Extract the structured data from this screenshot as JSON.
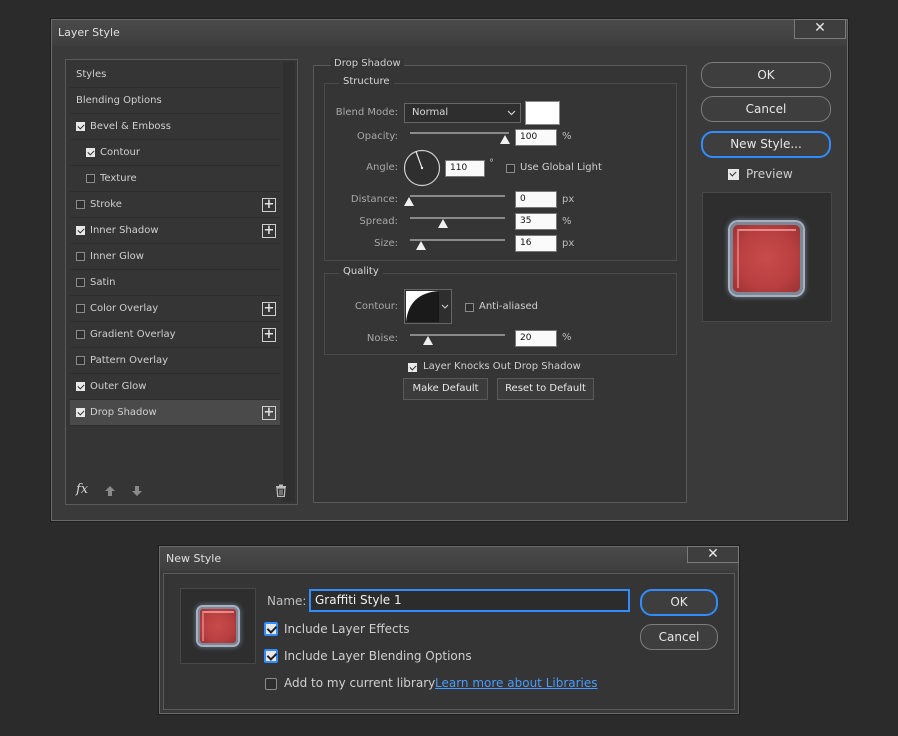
{
  "layer_style": {
    "title": "Layer Style",
    "close_label": "✕",
    "items": [
      {
        "label": "Styles",
        "checkbox": false,
        "checked": false,
        "plus": false
      },
      {
        "label": "Blending Options",
        "checkbox": false,
        "checked": false,
        "plus": false
      },
      {
        "label": "Bevel & Emboss",
        "checkbox": true,
        "checked": true,
        "plus": false
      },
      {
        "label": "Contour",
        "checkbox": true,
        "checked": true,
        "plus": false,
        "indent": true
      },
      {
        "label": "Texture",
        "checkbox": true,
        "checked": false,
        "plus": false,
        "indent": true
      },
      {
        "label": "Stroke",
        "checkbox": true,
        "checked": false,
        "plus": true
      },
      {
        "label": "Inner Shadow",
        "checkbox": true,
        "checked": true,
        "plus": true
      },
      {
        "label": "Inner Glow",
        "checkbox": true,
        "checked": false,
        "plus": false
      },
      {
        "label": "Satin",
        "checkbox": true,
        "checked": false,
        "plus": false
      },
      {
        "label": "Color Overlay",
        "checkbox": true,
        "checked": false,
        "plus": true
      },
      {
        "label": "Gradient Overlay",
        "checkbox": true,
        "checked": false,
        "plus": true
      },
      {
        "label": "Pattern Overlay",
        "checkbox": true,
        "checked": false,
        "plus": false
      },
      {
        "label": "Outer Glow",
        "checkbox": true,
        "checked": true,
        "plus": false
      },
      {
        "label": "Drop Shadow",
        "checkbox": true,
        "checked": true,
        "plus": true,
        "selected": true
      }
    ],
    "fx_label": "fx",
    "drop_shadow": {
      "section_title": "Drop Shadow",
      "structure": {
        "title": "Structure",
        "blend_mode_label": "Blend Mode:",
        "blend_mode_value": "Normal",
        "opacity_label": "Opacity:",
        "opacity_value": "100",
        "opacity_unit": "%",
        "angle_label": "Angle:",
        "angle_value": "110",
        "angle_unit": "°",
        "use_global_light_label": "Use Global Light",
        "distance_label": "Distance:",
        "distance_value": "0",
        "distance_unit": "px",
        "spread_label": "Spread:",
        "spread_value": "35",
        "spread_unit": "%",
        "size_label": "Size:",
        "size_value": "16",
        "size_unit": "px"
      },
      "quality": {
        "title": "Quality",
        "contour_label": "Contour:",
        "anti_aliased_label": "Anti-aliased",
        "noise_label": "Noise:",
        "noise_value": "20",
        "noise_unit": "%"
      },
      "knocks_out_label": "Layer Knocks Out Drop Shadow",
      "make_default_label": "Make Default",
      "reset_default_label": "Reset to Default"
    },
    "ok_label": "OK",
    "cancel_label": "Cancel",
    "new_style_label": "New Style...",
    "preview_label": "Preview"
  },
  "new_style": {
    "title": "New Style",
    "close_label": "✕",
    "name_label": "Name:",
    "name_value": "Graffiti Style 1",
    "include_effects_label": "Include Layer Effects",
    "include_blending_label": "Include Layer Blending Options",
    "add_library_label": "Add to my current library",
    "learn_more_label": "Learn more about Libraries",
    "ok_label": "OK",
    "cancel_label": "Cancel"
  },
  "colors": {
    "accent": "#2f8dff",
    "link": "#4a9bff",
    "tile_red": "#c94b4b"
  }
}
